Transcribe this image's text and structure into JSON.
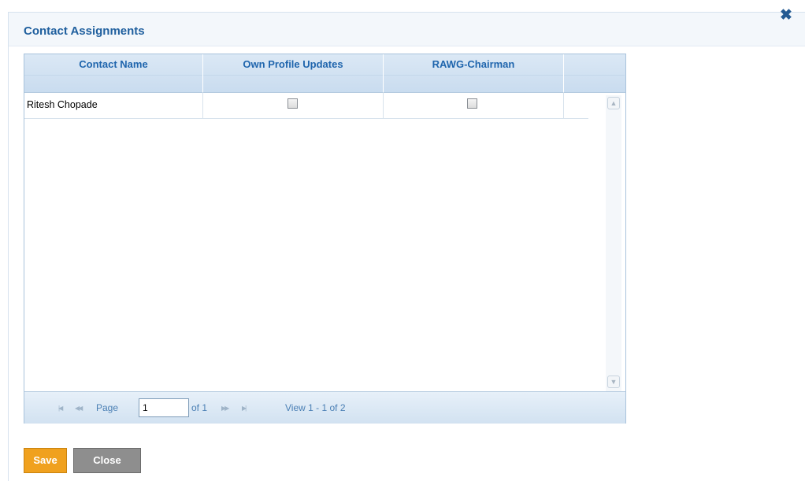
{
  "dialog": {
    "title": "Contact Assignments",
    "close_icon": "close-x-icon"
  },
  "grid": {
    "columns": [
      "Contact Name",
      "Own Profile Updates",
      "RAWG-Chairman"
    ],
    "rows": [
      {
        "contact_name": "Ritesh Chopade",
        "own_profile_updates": false,
        "rawg_chairman": false
      }
    ]
  },
  "pager": {
    "page_label": "Page",
    "page_value": "1",
    "of_label": "of 1",
    "view_text": "View 1 - 1 of 2",
    "icons": [
      "first-page-icon",
      "prev-page-icon",
      "next-page-icon",
      "last-page-icon"
    ]
  },
  "buttons": {
    "save": "Save",
    "close": "Close"
  },
  "colors": {
    "title": "#1f5f9e",
    "header_gradient_top": "#dbe8f5",
    "save_button": "#f0a11e",
    "close_button": "#8e8e8e"
  }
}
